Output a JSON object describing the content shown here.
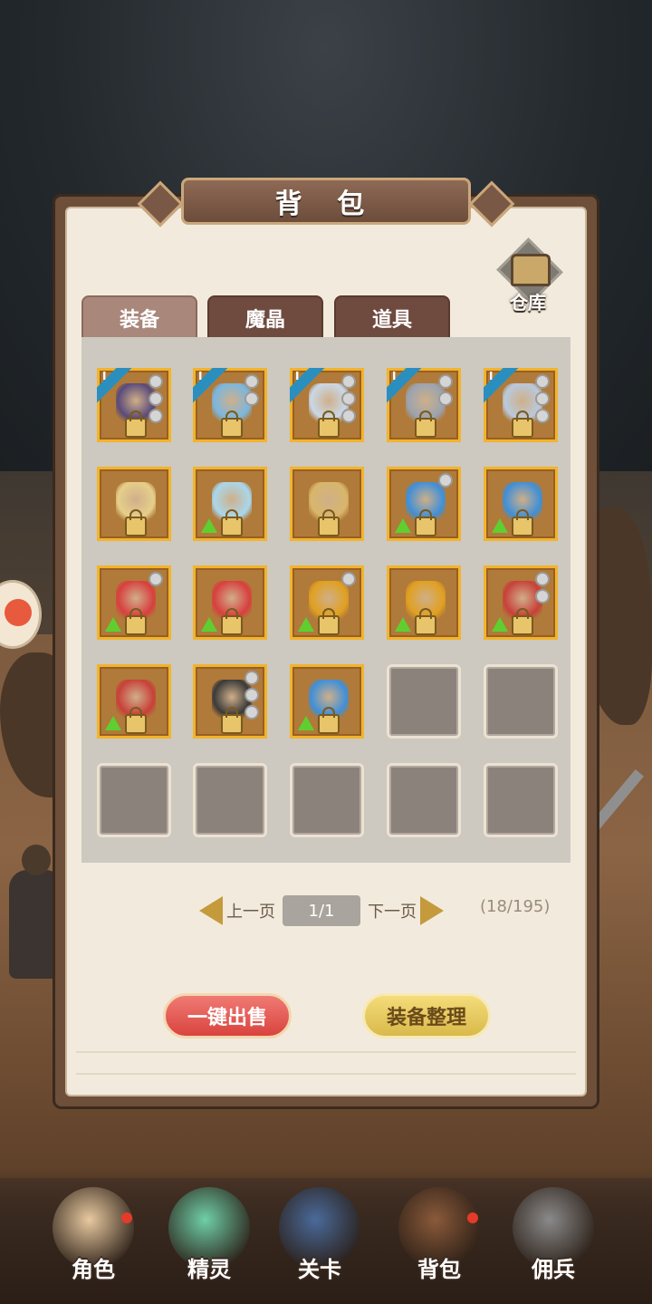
{
  "panel": {
    "title": "背 包",
    "warehouse_label": "仓库"
  },
  "tabs": [
    {
      "label": "装备",
      "active": true
    },
    {
      "label": "魔晶",
      "active": false
    },
    {
      "label": "道具",
      "active": false
    }
  ],
  "items": [
    {
      "icon": "dark-winged-crown-icon",
      "art": "#5a4a7a",
      "ribbon": "I",
      "dots": 3,
      "upgrade": false
    },
    {
      "icon": "ice-sword-icon",
      "art": "#7ab7e0",
      "ribbon": "I",
      "dots": 2,
      "upgrade": false
    },
    {
      "icon": "crystal-spear-icon",
      "art": "#c9d8e8",
      "ribbon": "I",
      "dots": 3,
      "upgrade": false
    },
    {
      "icon": "knight-helmet-icon",
      "art": "#9aa3b0",
      "ribbon": "I",
      "dots": 2,
      "upgrade": false
    },
    {
      "icon": "plate-armor-icon",
      "art": "#b9c9dc",
      "ribbon": "I",
      "dots": 3,
      "upgrade": false
    },
    {
      "icon": "golden-scythe-icon",
      "art": "#e6cf8a",
      "ribbon": "",
      "dots": 0,
      "upgrade": false
    },
    {
      "icon": "crystal-dagger-icon",
      "art": "#a9d7ec",
      "ribbon": "",
      "dots": 0,
      "upgrade": true
    },
    {
      "icon": "golden-amulet-icon",
      "art": "#d8b66a",
      "ribbon": "",
      "dots": 0,
      "upgrade": false
    },
    {
      "icon": "blue-gem-ring-icon",
      "art": "#3f8fd8",
      "ribbon": "",
      "dots": 1,
      "upgrade": true
    },
    {
      "icon": "blue-gem-ring-icon",
      "art": "#3f8fd8",
      "ribbon": "",
      "dots": 0,
      "upgrade": true
    },
    {
      "icon": "red-gem-ring-icon",
      "art": "#d83f3f",
      "ribbon": "",
      "dots": 1,
      "upgrade": true
    },
    {
      "icon": "red-gem-ring-icon",
      "art": "#d83f3f",
      "ribbon": "",
      "dots": 0,
      "upgrade": true
    },
    {
      "icon": "amber-gem-ring-icon",
      "art": "#e0a020",
      "ribbon": "",
      "dots": 1,
      "upgrade": true
    },
    {
      "icon": "amber-gem-ring-icon",
      "art": "#e0a020",
      "ribbon": "",
      "dots": 0,
      "upgrade": true
    },
    {
      "icon": "crimson-blade-icon",
      "art": "#c8403a",
      "ribbon": "",
      "dots": 2,
      "upgrade": true
    },
    {
      "icon": "crimson-blade-icon",
      "art": "#c8403a",
      "ribbon": "",
      "dots": 0,
      "upgrade": true
    },
    {
      "icon": "black-armor-icon",
      "art": "#3a3a3a",
      "ribbon": "",
      "dots": 3,
      "upgrade": false
    },
    {
      "icon": "blue-gem-ring-icon",
      "art": "#3f8fd8",
      "ribbon": "",
      "dots": 0,
      "upgrade": true
    },
    null,
    null,
    null,
    null,
    null,
    null,
    null
  ],
  "pager": {
    "prev": "上一页",
    "page": "1/1",
    "next": "下一页",
    "count": "(18/195)"
  },
  "buttons": {
    "sell": "一键出售",
    "sort": "装备整理"
  },
  "nav": [
    {
      "label": "角色",
      "icon": "character-icon",
      "color": "#e8c9a0",
      "badge": true
    },
    {
      "label": "精灵",
      "icon": "spirit-icon",
      "color": "#6fcfa8",
      "badge": false
    },
    {
      "label": "关卡",
      "icon": "stage-icon",
      "color": "#4a6a9a",
      "badge": false
    },
    {
      "label": "背包",
      "icon": "backpack-icon",
      "color": "#8a5a3a",
      "badge": true
    },
    {
      "label": "佣兵",
      "icon": "mercenary-icon",
      "color": "#8a8a8a",
      "badge": false
    }
  ]
}
